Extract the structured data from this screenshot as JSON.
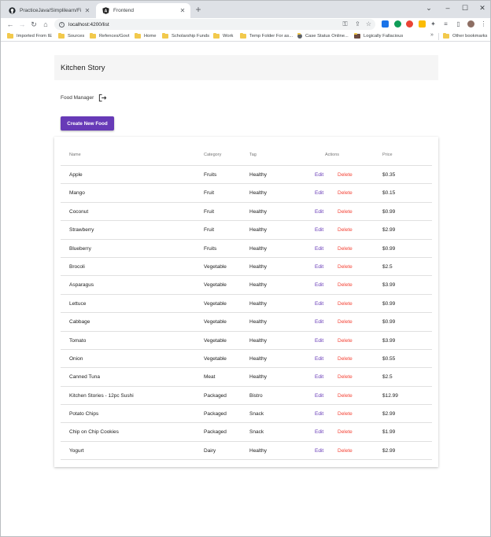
{
  "browser": {
    "tabs": [
      {
        "title": "PracticeJava/Simplilearn/Final Pr",
        "active": false
      },
      {
        "title": "Frontend",
        "active": true
      }
    ],
    "url": "localhost:4200/list",
    "bookmarks": [
      "Imported From IE",
      "Sources",
      "Refences/Govt",
      "Home",
      "Scholarship Funds",
      "Work",
      "Temp Folder For as...",
      "Case Status Online...",
      "Logically Fallacious"
    ],
    "other_bookmarks": "Other bookmarks"
  },
  "app": {
    "title": "Kitchen Story",
    "subtitle": "Food Manager",
    "create_label": "Create New Food",
    "accent_color": "#673ab7",
    "delete_color": "#f44336"
  },
  "table": {
    "headers": {
      "name": "Name",
      "category": "Category",
      "tag": "Tag",
      "actions": "Actions",
      "price": "Price"
    },
    "edit_label": "Edit",
    "delete_label": "Delete",
    "rows": [
      {
        "name": "Apple",
        "category": "Fruits",
        "tag": "Healthy",
        "price": "$0.35"
      },
      {
        "name": "Mango",
        "category": "Fruit",
        "tag": "Healthy",
        "price": "$0.15"
      },
      {
        "name": "Coconut",
        "category": "Fruit",
        "tag": "Healthy",
        "price": "$0.99"
      },
      {
        "name": "Strawberry",
        "category": "Fruit",
        "tag": "Healthy",
        "price": "$2.99"
      },
      {
        "name": "Blueberry",
        "category": "Fruits",
        "tag": "Healthy",
        "price": "$0.99"
      },
      {
        "name": "Brocoli",
        "category": "Vegetable",
        "tag": "Healthy",
        "price": "$2.5"
      },
      {
        "name": "Asparagus",
        "category": "Vegetable",
        "tag": "Healthy",
        "price": "$3.99"
      },
      {
        "name": "Lettuce",
        "category": "Vegetable",
        "tag": "Healthy",
        "price": "$0.99"
      },
      {
        "name": "Cabbage",
        "category": "Vegetable",
        "tag": "Healthy",
        "price": "$0.99"
      },
      {
        "name": "Tomato",
        "category": "Vegetable",
        "tag": "Healthy",
        "price": "$3.99"
      },
      {
        "name": "Onion",
        "category": "Vegetable",
        "tag": "Healthy",
        "price": "$0.55"
      },
      {
        "name": "Canned Tuna",
        "category": "Meat",
        "tag": "Healthy",
        "price": "$2.5"
      },
      {
        "name": "Kitchen Stories - 12pc Sushi",
        "category": "Packaged",
        "tag": "Bistro",
        "price": "$12.99"
      },
      {
        "name": "Potato Chips",
        "category": "Packaged",
        "tag": "Snack",
        "price": "$2.99"
      },
      {
        "name": "Chip on Chip Cookies",
        "category": "Packaged",
        "tag": "Snack",
        "price": "$1.99"
      },
      {
        "name": "Yogurt",
        "category": "Dairy",
        "tag": "Healthy",
        "price": "$2.99"
      }
    ]
  }
}
